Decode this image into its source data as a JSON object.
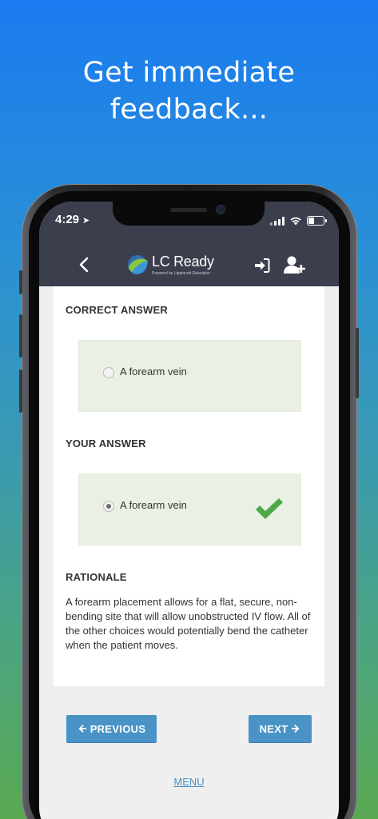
{
  "promo": {
    "headline_line1": "Get immediate",
    "headline_line2": "feedback..."
  },
  "status_bar": {
    "time": "4:29"
  },
  "nav": {
    "logo_text": "LC Ready",
    "logo_subtext": "Powered by Lippincott Education"
  },
  "correct_answer": {
    "label": "CORRECT ANSWER",
    "choice": "A forearm vein"
  },
  "your_answer": {
    "label": "YOUR ANSWER",
    "choice": "A forearm vein",
    "is_correct": true
  },
  "rationale": {
    "label": "RATIONALE",
    "text": "A forearm placement allows for a flat, secure, non-bending site that will allow unobstructed IV flow. All of the other choices would potentially bend the catheter when the patient moves."
  },
  "footer": {
    "previous_label": "PREVIOUS",
    "next_label": "NEXT",
    "menu_label": "MENU"
  },
  "colors": {
    "navbar": "#3b3e4c",
    "button": "#4993c6",
    "answer_box": "#eaf1e4",
    "check": "#4ca848"
  }
}
